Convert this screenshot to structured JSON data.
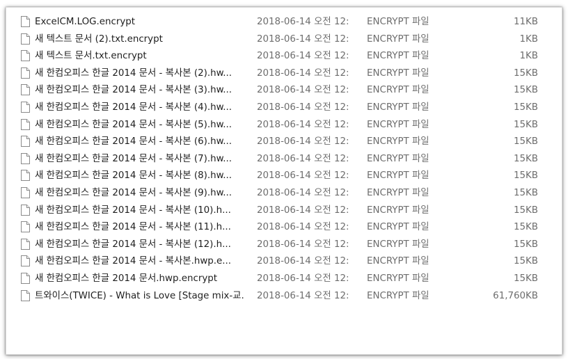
{
  "file_list": {
    "icon": "generic-file-icon",
    "rows": [
      {
        "name": "ExcelCM.LOG.encrypt",
        "date": "2018-06-14 오전 12:",
        "type": "ENCRYPT 파일",
        "size": "11KB"
      },
      {
        "name": "새 텍스트 문서 (2).txt.encrypt",
        "date": "2018-06-14 오전 12:",
        "type": "ENCRYPT 파일",
        "size": "1KB"
      },
      {
        "name": "새 텍스트 문서.txt.encrypt",
        "date": "2018-06-14 오전 12:",
        "type": "ENCRYPT 파일",
        "size": "1KB"
      },
      {
        "name": "새 한컴오피스 한글 2014 문서 - 복사본 (2).hw...",
        "date": "2018-06-14 오전 12:",
        "type": "ENCRYPT 파일",
        "size": "15KB"
      },
      {
        "name": "새 한컴오피스 한글 2014 문서 - 복사본 (3).hw...",
        "date": "2018-06-14 오전 12:",
        "type": "ENCRYPT 파일",
        "size": "15KB"
      },
      {
        "name": "새 한컴오피스 한글 2014 문서 - 복사본 (4).hw...",
        "date": "2018-06-14 오전 12:",
        "type": "ENCRYPT 파일",
        "size": "15KB"
      },
      {
        "name": "새 한컴오피스 한글 2014 문서 - 복사본 (5).hw...",
        "date": "2018-06-14 오전 12:",
        "type": "ENCRYPT 파일",
        "size": "15KB"
      },
      {
        "name": "새 한컴오피스 한글 2014 문서 - 복사본 (6).hw...",
        "date": "2018-06-14 오전 12:",
        "type": "ENCRYPT 파일",
        "size": "15KB"
      },
      {
        "name": "새 한컴오피스 한글 2014 문서 - 복사본 (7).hw...",
        "date": "2018-06-14 오전 12:",
        "type": "ENCRYPT 파일",
        "size": "15KB"
      },
      {
        "name": "새 한컴오피스 한글 2014 문서 - 복사본 (8).hw...",
        "date": "2018-06-14 오전 12:",
        "type": "ENCRYPT 파일",
        "size": "15KB"
      },
      {
        "name": "새 한컴오피스 한글 2014 문서 - 복사본 (9).hw...",
        "date": "2018-06-14 오전 12:",
        "type": "ENCRYPT 파일",
        "size": "15KB"
      },
      {
        "name": "새 한컴오피스 한글 2014 문서 - 복사본 (10).h...",
        "date": "2018-06-14 오전 12:",
        "type": "ENCRYPT 파일",
        "size": "15KB"
      },
      {
        "name": "새 한컴오피스 한글 2014 문서 - 복사본 (11).h...",
        "date": "2018-06-14 오전 12:",
        "type": "ENCRYPT 파일",
        "size": "15KB"
      },
      {
        "name": "새 한컴오피스 한글 2014 문서 - 복사본 (12).h...",
        "date": "2018-06-14 오전 12:",
        "type": "ENCRYPT 파일",
        "size": "15KB"
      },
      {
        "name": "새 한컴오피스 한글 2014 문서 - 복사본.hwp.e...",
        "date": "2018-06-14 오전 12:",
        "type": "ENCRYPT 파일",
        "size": "15KB"
      },
      {
        "name": "새 한컴오피스 한글 2014 문서.hwp.encrypt",
        "date": "2018-06-14 오전 12:",
        "type": "ENCRYPT 파일",
        "size": "15KB"
      },
      {
        "name": "트와이스(TWICE) - What is Love [Stage mix-교...",
        "date": "2018-06-14 오전 12:",
        "type": "ENCRYPT 파일",
        "size": "61,760KB"
      }
    ]
  }
}
